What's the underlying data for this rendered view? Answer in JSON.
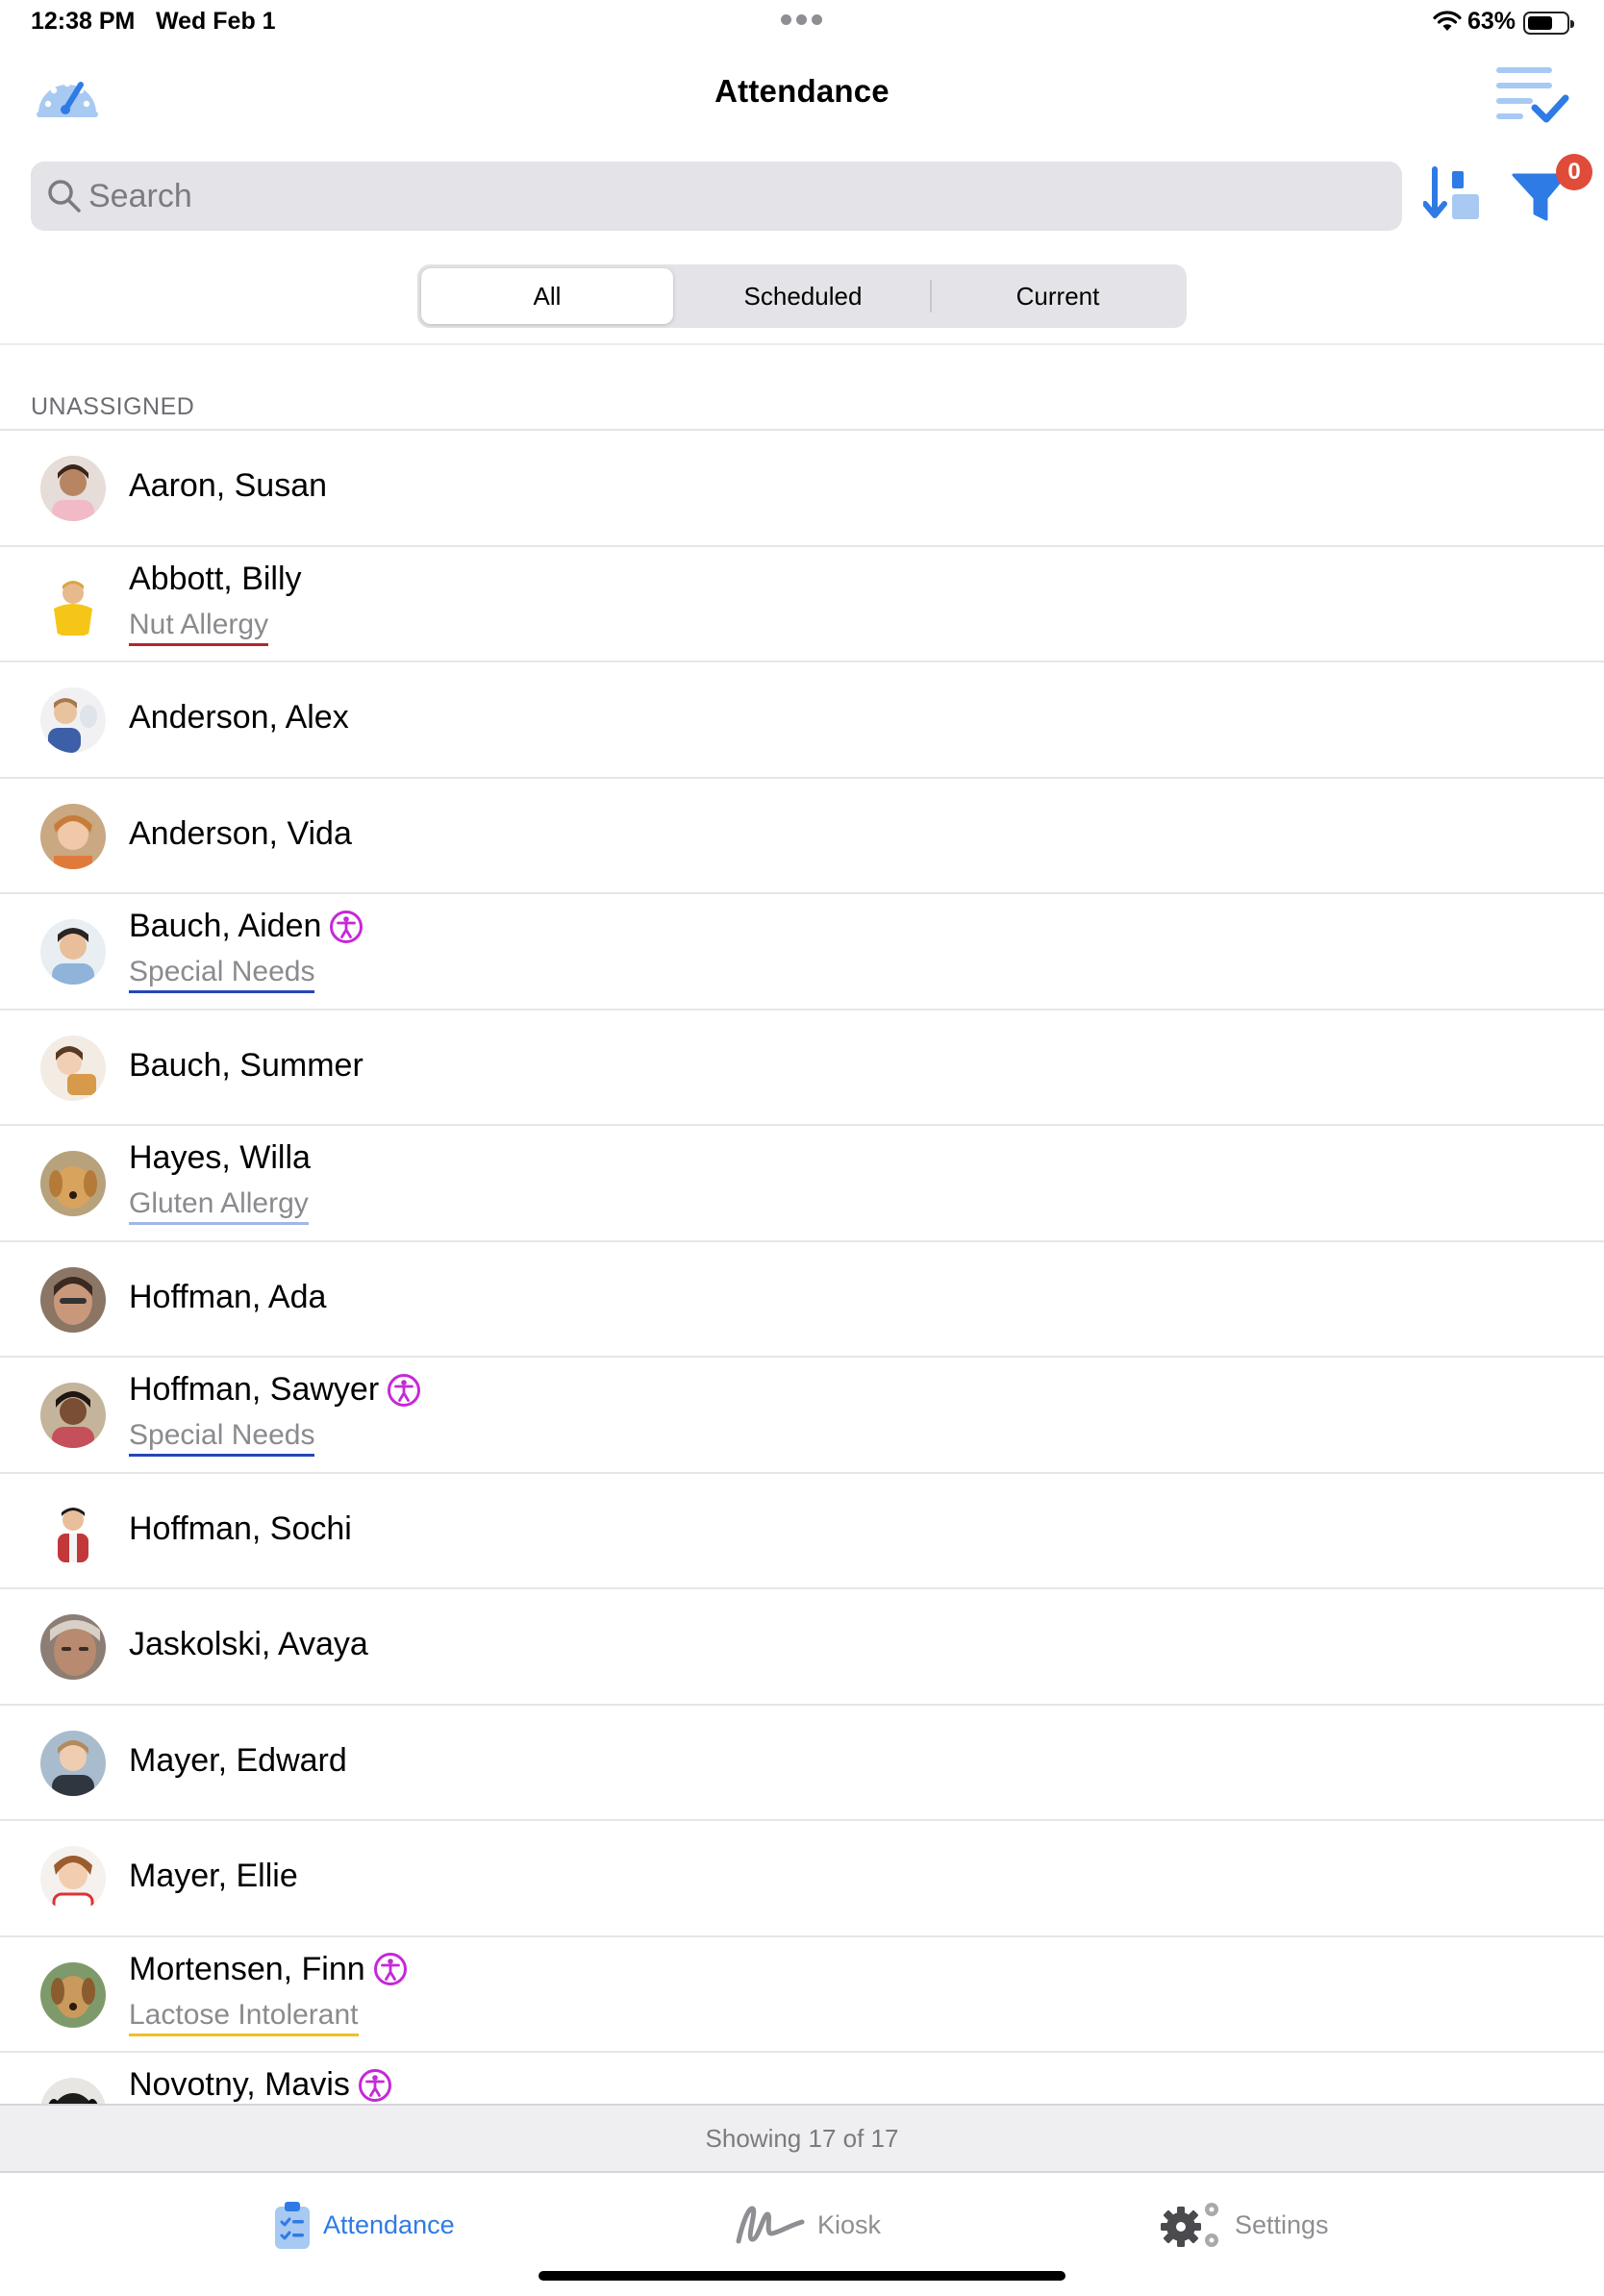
{
  "status_bar": {
    "time": "12:38 PM",
    "date": "Wed Feb 1",
    "battery_percent": "63%",
    "battery_level": 0.63,
    "icons": [
      "more-dots-icon",
      "wifi-icon",
      "battery-icon"
    ]
  },
  "nav": {
    "title": "Attendance",
    "left_icon": "dashboard-gauge-icon",
    "right_icon": "list-check-icon"
  },
  "search": {
    "placeholder": "Search",
    "value": ""
  },
  "toolbar": {
    "sort_icon": "sort-icon",
    "filter_icon": "filter-icon",
    "filter_badge": "0"
  },
  "segments": {
    "items": [
      {
        "label": "All",
        "selected": true
      },
      {
        "label": "Scheduled",
        "selected": false
      },
      {
        "label": "Current",
        "selected": false
      }
    ]
  },
  "section": {
    "header": "UNASSIGNED"
  },
  "people": [
    {
      "name": "Aaron, Susan",
      "tag": "",
      "special_needs_icon": false
    },
    {
      "name": "Abbott, Billy",
      "tag": "Nut Allergy",
      "tag_color": "#b5262a",
      "special_needs_icon": false
    },
    {
      "name": "Anderson, Alex",
      "tag": "",
      "special_needs_icon": false
    },
    {
      "name": "Anderson, Vida",
      "tag": "",
      "special_needs_icon": false
    },
    {
      "name": "Bauch, Aiden",
      "tag": "Special Needs",
      "tag_color": "#2447b8",
      "special_needs_icon": true
    },
    {
      "name": "Bauch, Summer",
      "tag": "",
      "special_needs_icon": false
    },
    {
      "name": "Hayes, Willa",
      "tag": "Gluten Allergy",
      "tag_color": "#9fb7e8",
      "special_needs_icon": false
    },
    {
      "name": "Hoffman, Ada",
      "tag": "",
      "special_needs_icon": false
    },
    {
      "name": "Hoffman, Sawyer",
      "tag": "Special Needs",
      "tag_color": "#2447b8",
      "special_needs_icon": true
    },
    {
      "name": "Hoffman, Sochi",
      "tag": "",
      "special_needs_icon": false
    },
    {
      "name": "Jaskolski, Avaya",
      "tag": "",
      "special_needs_icon": false
    },
    {
      "name": "Mayer, Edward",
      "tag": "",
      "special_needs_icon": false
    },
    {
      "name": "Mayer, Ellie",
      "tag": "",
      "special_needs_icon": false
    },
    {
      "name": "Mortensen, Finn",
      "tag": "Lactose Intolerant",
      "tag_color": "#f2bf25",
      "special_needs_icon": true
    },
    {
      "name": "Novotny, Mavis",
      "tag": "",
      "special_needs_icon": true
    }
  ],
  "footer": {
    "showing_text": "Showing 17 of 17"
  },
  "tabbar": {
    "tabs": [
      {
        "label": "Attendance",
        "icon": "clipboard-icon",
        "active": true
      },
      {
        "label": "Kiosk",
        "icon": "signature-icon",
        "active": false
      },
      {
        "label": "Settings",
        "icon": "gears-icon",
        "active": false
      }
    ]
  },
  "colors": {
    "accent": "#2f7be5",
    "accent_light": "#a8c9f2",
    "badge_red": "#e04b3a",
    "special_needs_purple": "#c628d8",
    "inactive_tab": "#8e8e93"
  }
}
